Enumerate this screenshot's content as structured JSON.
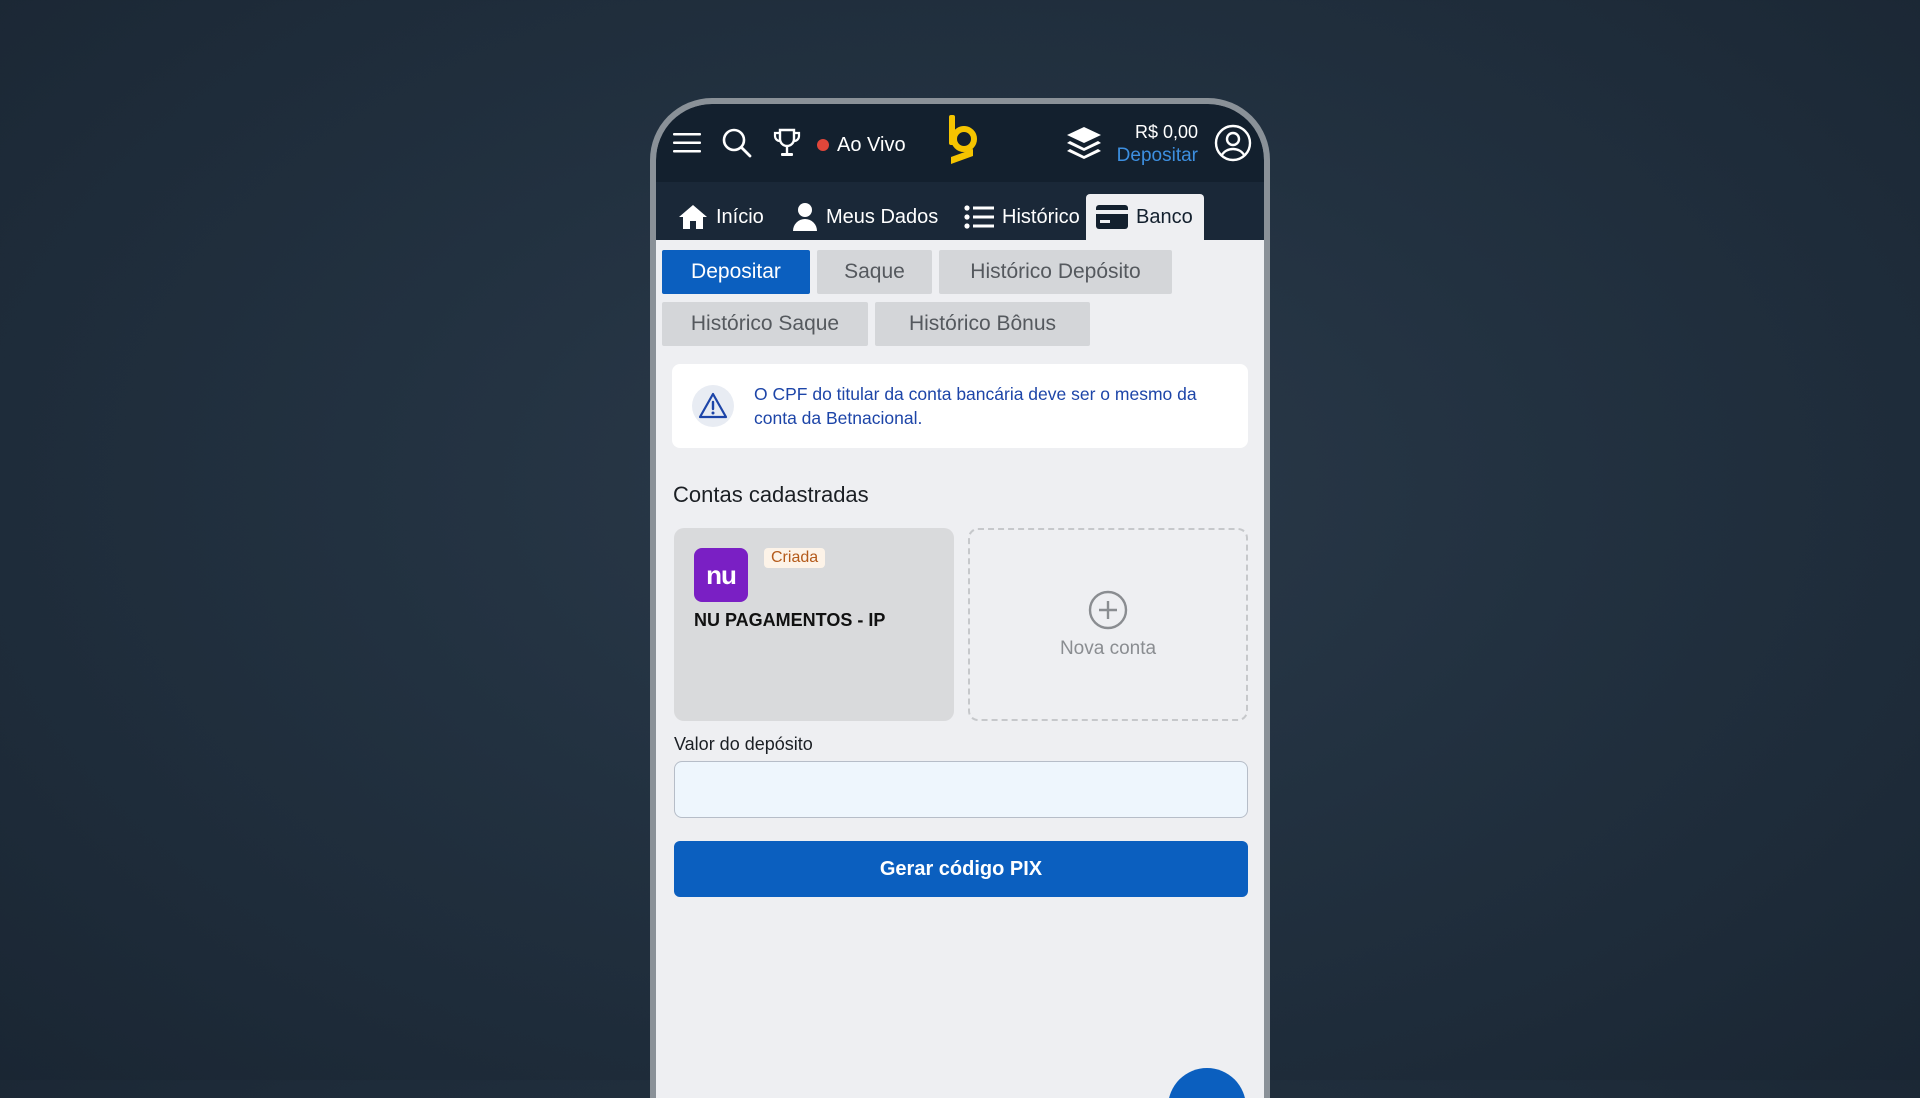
{
  "header": {
    "live_label": "Ao Vivo",
    "balance": "R$ 0,00",
    "deposit_link": "Depositar",
    "icons": [
      "menu-icon",
      "search-icon",
      "trophy-icon",
      "betnacional-logo",
      "layers-icon",
      "user-circle-icon"
    ]
  },
  "nav": {
    "items": [
      {
        "label": "Início",
        "icon": "home-icon"
      },
      {
        "label": "Meus Dados",
        "icon": "user-icon"
      },
      {
        "label": "Histórico",
        "icon": "list-icon"
      },
      {
        "label": "Banco",
        "icon": "card-icon",
        "active": true
      }
    ]
  },
  "subtabs": [
    {
      "label": "Depositar",
      "active": true
    },
    {
      "label": "Saque"
    },
    {
      "label": "Histórico Depósito"
    },
    {
      "label": "Histórico Saque"
    },
    {
      "label": "Histórico Bônus"
    }
  ],
  "alert": {
    "icon": "warning-icon",
    "message": "O CPF do titular da conta bancária deve ser o mesmo da conta da Betnacional."
  },
  "accounts": {
    "title": "Contas cadastradas",
    "items": [
      {
        "logo_text": "nu",
        "badge": "Criada",
        "name": "NU PAGAMENTOS - IP"
      }
    ],
    "new_account_label": "Nova conta"
  },
  "deposit": {
    "label": "Valor do depósito",
    "value": "",
    "placeholder": ""
  },
  "pix_button": "Gerar código PIX",
  "colors": {
    "primary": "#0b5fbf",
    "header_bg": "#13202e",
    "brand_yellow": "#f5c400",
    "alert_text": "#1d45a8",
    "badge_text": "#b45a1a",
    "nu_purple": "#7a1fc4"
  }
}
